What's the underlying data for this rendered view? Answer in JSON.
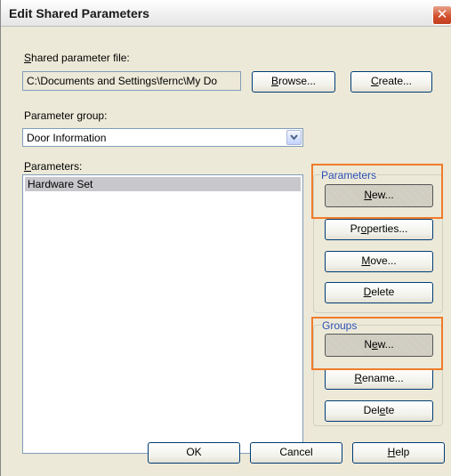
{
  "window": {
    "title": "Edit Shared Parameters",
    "close_label": "✕"
  },
  "shared_file": {
    "label_accel": "S",
    "label_rest": "hared parameter file:",
    "value": "C:\\Documents and Settings\\fernc\\My Do",
    "browse_accel": "B",
    "browse_rest": "rowse...",
    "create_accel": "C",
    "create_rest": "reate..."
  },
  "parameter_group": {
    "label_pre": "Parameter ",
    "label_accel": "g",
    "label_rest": "roup:",
    "selected": "Door Information"
  },
  "parameters": {
    "label_accel": "P",
    "label_rest": "arameters:",
    "items": [
      "Hardware Set"
    ]
  },
  "parameters_group": {
    "title": "Parameters",
    "new_accel": "N",
    "new_rest": "ew...",
    "properties_pre": "Pr",
    "properties_accel": "o",
    "properties_rest": "perties...",
    "move_accel": "M",
    "move_rest": "ove...",
    "delete_accel": "D",
    "delete_rest": "elete"
  },
  "groups_group": {
    "title": "Groups",
    "new_pre": "N",
    "new_accel": "e",
    "new_rest": "w...",
    "rename_accel": "R",
    "rename_rest": "ename...",
    "delete_pre": "Del",
    "delete_accel": "e",
    "delete_rest": "te"
  },
  "footer": {
    "ok_label": "OK",
    "cancel_label": "Cancel",
    "help_accel": "H",
    "help_rest": "elp"
  },
  "colors": {
    "highlight": "#f07c2a",
    "group_title": "#2c4fb5",
    "dialog_bg": "#ece9d8"
  }
}
